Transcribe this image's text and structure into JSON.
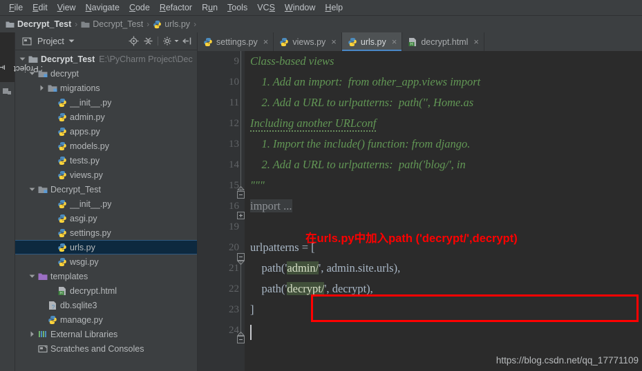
{
  "menu": {
    "items": [
      {
        "label": "File",
        "mnemonic": "F"
      },
      {
        "label": "Edit",
        "mnemonic": "E"
      },
      {
        "label": "View",
        "mnemonic": "V"
      },
      {
        "label": "Navigate",
        "mnemonic": "N"
      },
      {
        "label": "Code",
        "mnemonic": "C"
      },
      {
        "label": "Refactor",
        "mnemonic": "R"
      },
      {
        "label": "Run",
        "mnemonic": "u"
      },
      {
        "label": "Tools",
        "mnemonic": "T"
      },
      {
        "label": "VCS",
        "mnemonic": "S"
      },
      {
        "label": "Window",
        "mnemonic": "W"
      },
      {
        "label": "Help",
        "mnemonic": "H"
      }
    ]
  },
  "breadcrumb": {
    "items": [
      {
        "label": "Decrypt_Test",
        "icon": "folder-icon",
        "bold": true
      },
      {
        "label": "Decrypt_Test",
        "icon": "folder-icon",
        "bold": false
      },
      {
        "label": "urls.py",
        "icon": "python-file-icon",
        "bold": false
      }
    ],
    "separator": "›"
  },
  "toolwindow_strip": {
    "project_tab": "1: Project",
    "project_tab_mnemonic": "1"
  },
  "project_panel": {
    "title": "Project",
    "dropdown_icon": "chevron-down-icon",
    "header_icons": [
      "locate-target-icon",
      "collapse-all-icon",
      "settings-gear-icon",
      "hide-panel-icon"
    ],
    "tree": [
      {
        "label": "Decrypt_Test",
        "path": "E:\\PyCharm Project\\Dec",
        "depth": 0,
        "icon": "folder-icon",
        "arrow": "down",
        "bold": true,
        "selected": false
      },
      {
        "label": "decrypt",
        "path": "",
        "depth": 1,
        "icon": "module-folder-icon",
        "arrow": "down",
        "bold": false,
        "selected": false
      },
      {
        "label": "migrations",
        "path": "",
        "depth": 2,
        "icon": "module-folder-icon",
        "arrow": "right",
        "bold": false,
        "selected": false
      },
      {
        "label": "__init__.py",
        "path": "",
        "depth": 3,
        "icon": "python-file-icon",
        "arrow": "none",
        "bold": false,
        "selected": false
      },
      {
        "label": "admin.py",
        "path": "",
        "depth": 3,
        "icon": "python-file-icon",
        "arrow": "none",
        "bold": false,
        "selected": false
      },
      {
        "label": "apps.py",
        "path": "",
        "depth": 3,
        "icon": "python-file-icon",
        "arrow": "none",
        "bold": false,
        "selected": false
      },
      {
        "label": "models.py",
        "path": "",
        "depth": 3,
        "icon": "python-file-icon",
        "arrow": "none",
        "bold": false,
        "selected": false
      },
      {
        "label": "tests.py",
        "path": "",
        "depth": 3,
        "icon": "python-file-icon",
        "arrow": "none",
        "bold": false,
        "selected": false
      },
      {
        "label": "views.py",
        "path": "",
        "depth": 3,
        "icon": "python-file-icon",
        "arrow": "none",
        "bold": false,
        "selected": false
      },
      {
        "label": "Decrypt_Test",
        "path": "",
        "depth": 1,
        "icon": "module-folder-icon",
        "arrow": "down",
        "bold": false,
        "selected": false
      },
      {
        "label": "__init__.py",
        "path": "",
        "depth": 3,
        "icon": "python-file-icon",
        "arrow": "none",
        "bold": false,
        "selected": false
      },
      {
        "label": "asgi.py",
        "path": "",
        "depth": 3,
        "icon": "python-file-icon",
        "arrow": "none",
        "bold": false,
        "selected": false
      },
      {
        "label": "settings.py",
        "path": "",
        "depth": 3,
        "icon": "python-file-icon",
        "arrow": "none",
        "bold": false,
        "selected": false
      },
      {
        "label": "urls.py",
        "path": "",
        "depth": 3,
        "icon": "python-file-icon",
        "arrow": "none",
        "bold": false,
        "selected": true
      },
      {
        "label": "wsgi.py",
        "path": "",
        "depth": 3,
        "icon": "python-file-icon",
        "arrow": "none",
        "bold": false,
        "selected": false
      },
      {
        "label": "templates",
        "path": "",
        "depth": 1,
        "icon": "templates-folder-icon",
        "arrow": "down",
        "bold": false,
        "selected": false
      },
      {
        "label": "decrypt.html",
        "path": "",
        "depth": 3,
        "icon": "html-file-icon",
        "arrow": "none",
        "bold": false,
        "selected": false
      },
      {
        "label": "db.sqlite3",
        "path": "",
        "depth": 2,
        "icon": "unknown-file-icon",
        "arrow": "none",
        "bold": false,
        "selected": false
      },
      {
        "label": "manage.py",
        "path": "",
        "depth": 2,
        "icon": "python-file-icon",
        "arrow": "none",
        "bold": false,
        "selected": false
      },
      {
        "label": "External Libraries",
        "path": "",
        "depth": 1,
        "icon": "libraries-icon",
        "arrow": "right",
        "bold": false,
        "selected": false
      },
      {
        "label": "Scratches and Consoles",
        "path": "",
        "depth": 1,
        "icon": "scratches-icon",
        "arrow": "none",
        "bold": false,
        "selected": false
      }
    ]
  },
  "editor_tabs": [
    {
      "label": "settings.py",
      "icon": "python-file-icon",
      "active": false,
      "close_icon": "close-icon"
    },
    {
      "label": "views.py",
      "icon": "python-file-icon",
      "active": false,
      "close_icon": "close-icon"
    },
    {
      "label": "urls.py",
      "icon": "python-file-icon",
      "active": true,
      "close_icon": "close-icon"
    },
    {
      "label": "decrypt.html",
      "icon": "html-file-icon",
      "active": false,
      "close_icon": "close-icon"
    }
  ],
  "editor": {
    "line_numbers": [
      "9",
      "10",
      "11",
      "12",
      "13",
      "14",
      "15",
      "16",
      "19",
      "20",
      "21",
      "22",
      "23",
      "24"
    ],
    "lines": [
      {
        "num": "9",
        "text": "Class-based views"
      },
      {
        "num": "10",
        "text": "    1. Add an import:  from other_app.views import"
      },
      {
        "num": "11",
        "text": "    2. Add a URL to urlpatterns:  path('', Home.as"
      },
      {
        "num": "12",
        "text": "Including another URLconf"
      },
      {
        "num": "13",
        "text": "    1. Import the include() function: from django."
      },
      {
        "num": "14",
        "text": "    2. Add a URL to urlpatterns:  path('blog/', in"
      },
      {
        "num": "15",
        "text": "\"\"\""
      },
      {
        "num": "16",
        "text": "import ..."
      },
      {
        "num": "19",
        "text": ""
      },
      {
        "num": "20",
        "text": "urlpatterns = ["
      },
      {
        "num": "21",
        "text": "    path('admin/', admin.site.urls),"
      },
      {
        "num": "22",
        "text": "    path('decrypt/', decrypt),"
      },
      {
        "num": "23",
        "text": "]"
      },
      {
        "num": "24",
        "text": ""
      }
    ],
    "line20_name": "urlpatterns",
    "line20_rest": " = [",
    "line21_prefix": "    path('",
    "line21_route": "admin/",
    "line21_mid": "', ",
    "line21_view": "admin.site.urls",
    "line21_suffix": "),",
    "line22_prefix": "    path('",
    "line22_route": "decrypt/",
    "line22_mid": "', ",
    "line22_view": "decrypt",
    "line22_suffix": "),",
    "folded_import": "import ...",
    "docstring_close": "\"\"\"",
    "bracket_close": "]"
  },
  "annotation": {
    "text": "在urls.py中加入path ('decrypt/',decrypt)",
    "color": "#ff0000"
  },
  "watermark": {
    "text": "https://blog.csdn.net/qq_17771109"
  }
}
